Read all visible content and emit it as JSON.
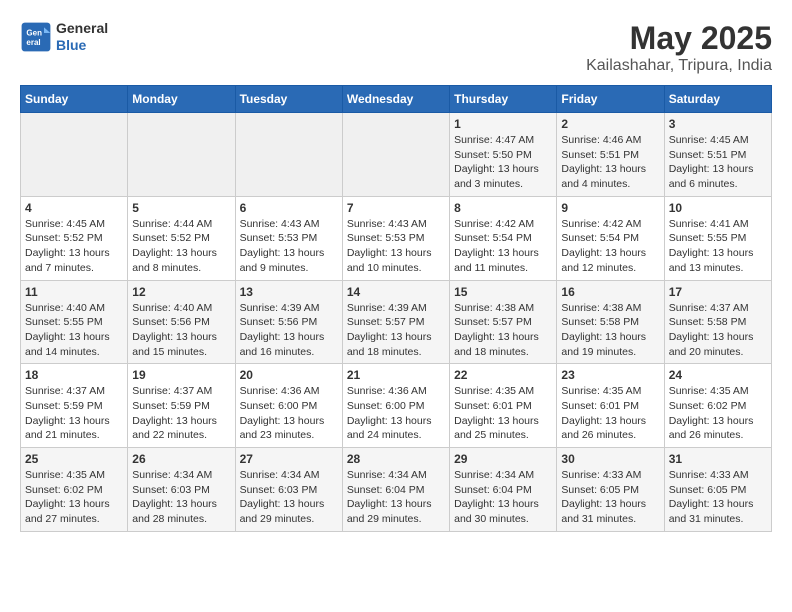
{
  "logo": {
    "general": "General",
    "blue": "Blue"
  },
  "title": "May 2025",
  "subtitle": "Kailashahar, Tripura, India",
  "days_of_week": [
    "Sunday",
    "Monday",
    "Tuesday",
    "Wednesday",
    "Thursday",
    "Friday",
    "Saturday"
  ],
  "weeks": [
    [
      {
        "day": "",
        "detail": ""
      },
      {
        "day": "",
        "detail": ""
      },
      {
        "day": "",
        "detail": ""
      },
      {
        "day": "",
        "detail": ""
      },
      {
        "day": "1",
        "detail": "Sunrise: 4:47 AM\nSunset: 5:50 PM\nDaylight: 13 hours and 3 minutes."
      },
      {
        "day": "2",
        "detail": "Sunrise: 4:46 AM\nSunset: 5:51 PM\nDaylight: 13 hours and 4 minutes."
      },
      {
        "day": "3",
        "detail": "Sunrise: 4:45 AM\nSunset: 5:51 PM\nDaylight: 13 hours and 6 minutes."
      }
    ],
    [
      {
        "day": "4",
        "detail": "Sunrise: 4:45 AM\nSunset: 5:52 PM\nDaylight: 13 hours and 7 minutes."
      },
      {
        "day": "5",
        "detail": "Sunrise: 4:44 AM\nSunset: 5:52 PM\nDaylight: 13 hours and 8 minutes."
      },
      {
        "day": "6",
        "detail": "Sunrise: 4:43 AM\nSunset: 5:53 PM\nDaylight: 13 hours and 9 minutes."
      },
      {
        "day": "7",
        "detail": "Sunrise: 4:43 AM\nSunset: 5:53 PM\nDaylight: 13 hours and 10 minutes."
      },
      {
        "day": "8",
        "detail": "Sunrise: 4:42 AM\nSunset: 5:54 PM\nDaylight: 13 hours and 11 minutes."
      },
      {
        "day": "9",
        "detail": "Sunrise: 4:42 AM\nSunset: 5:54 PM\nDaylight: 13 hours and 12 minutes."
      },
      {
        "day": "10",
        "detail": "Sunrise: 4:41 AM\nSunset: 5:55 PM\nDaylight: 13 hours and 13 minutes."
      }
    ],
    [
      {
        "day": "11",
        "detail": "Sunrise: 4:40 AM\nSunset: 5:55 PM\nDaylight: 13 hours and 14 minutes."
      },
      {
        "day": "12",
        "detail": "Sunrise: 4:40 AM\nSunset: 5:56 PM\nDaylight: 13 hours and 15 minutes."
      },
      {
        "day": "13",
        "detail": "Sunrise: 4:39 AM\nSunset: 5:56 PM\nDaylight: 13 hours and 16 minutes."
      },
      {
        "day": "14",
        "detail": "Sunrise: 4:39 AM\nSunset: 5:57 PM\nDaylight: 13 hours and 18 minutes."
      },
      {
        "day": "15",
        "detail": "Sunrise: 4:38 AM\nSunset: 5:57 PM\nDaylight: 13 hours and 18 minutes."
      },
      {
        "day": "16",
        "detail": "Sunrise: 4:38 AM\nSunset: 5:58 PM\nDaylight: 13 hours and 19 minutes."
      },
      {
        "day": "17",
        "detail": "Sunrise: 4:37 AM\nSunset: 5:58 PM\nDaylight: 13 hours and 20 minutes."
      }
    ],
    [
      {
        "day": "18",
        "detail": "Sunrise: 4:37 AM\nSunset: 5:59 PM\nDaylight: 13 hours and 21 minutes."
      },
      {
        "day": "19",
        "detail": "Sunrise: 4:37 AM\nSunset: 5:59 PM\nDaylight: 13 hours and 22 minutes."
      },
      {
        "day": "20",
        "detail": "Sunrise: 4:36 AM\nSunset: 6:00 PM\nDaylight: 13 hours and 23 minutes."
      },
      {
        "day": "21",
        "detail": "Sunrise: 4:36 AM\nSunset: 6:00 PM\nDaylight: 13 hours and 24 minutes."
      },
      {
        "day": "22",
        "detail": "Sunrise: 4:35 AM\nSunset: 6:01 PM\nDaylight: 13 hours and 25 minutes."
      },
      {
        "day": "23",
        "detail": "Sunrise: 4:35 AM\nSunset: 6:01 PM\nDaylight: 13 hours and 26 minutes."
      },
      {
        "day": "24",
        "detail": "Sunrise: 4:35 AM\nSunset: 6:02 PM\nDaylight: 13 hours and 26 minutes."
      }
    ],
    [
      {
        "day": "25",
        "detail": "Sunrise: 4:35 AM\nSunset: 6:02 PM\nDaylight: 13 hours and 27 minutes."
      },
      {
        "day": "26",
        "detail": "Sunrise: 4:34 AM\nSunset: 6:03 PM\nDaylight: 13 hours and 28 minutes."
      },
      {
        "day": "27",
        "detail": "Sunrise: 4:34 AM\nSunset: 6:03 PM\nDaylight: 13 hours and 29 minutes."
      },
      {
        "day": "28",
        "detail": "Sunrise: 4:34 AM\nSunset: 6:04 PM\nDaylight: 13 hours and 29 minutes."
      },
      {
        "day": "29",
        "detail": "Sunrise: 4:34 AM\nSunset: 6:04 PM\nDaylight: 13 hours and 30 minutes."
      },
      {
        "day": "30",
        "detail": "Sunrise: 4:33 AM\nSunset: 6:05 PM\nDaylight: 13 hours and 31 minutes."
      },
      {
        "day": "31",
        "detail": "Sunrise: 4:33 AM\nSunset: 6:05 PM\nDaylight: 13 hours and 31 minutes."
      }
    ]
  ]
}
